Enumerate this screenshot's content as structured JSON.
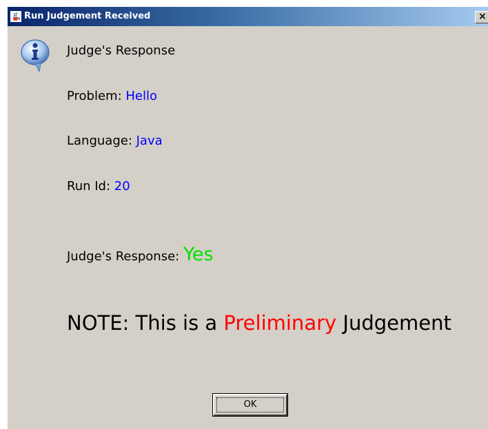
{
  "window": {
    "title": "Run Judgement Received",
    "close_label": "×"
  },
  "content": {
    "header": "Judge's Response",
    "problem_label": "Problem: ",
    "problem_value": "Hello",
    "language_label": "Language: ",
    "language_value": "Java",
    "runid_label": "Run Id: ",
    "runid_value": "20",
    "response_label": "Judge's Response: ",
    "response_value": "Yes",
    "note_prefix": "NOTE: This is a ",
    "note_highlight": "Preliminary",
    "note_suffix": " Judgement"
  },
  "buttons": {
    "ok_label": "OK"
  },
  "icons": {
    "window_icon": "java-cup-icon",
    "dialog_icon": "info-icon",
    "close_icon": "close-icon"
  },
  "colors": {
    "value_blue": "#0000ff",
    "yes_green": "#00e000",
    "preliminary_red": "#ff0000",
    "dialog_background": "#d4d0c8"
  }
}
